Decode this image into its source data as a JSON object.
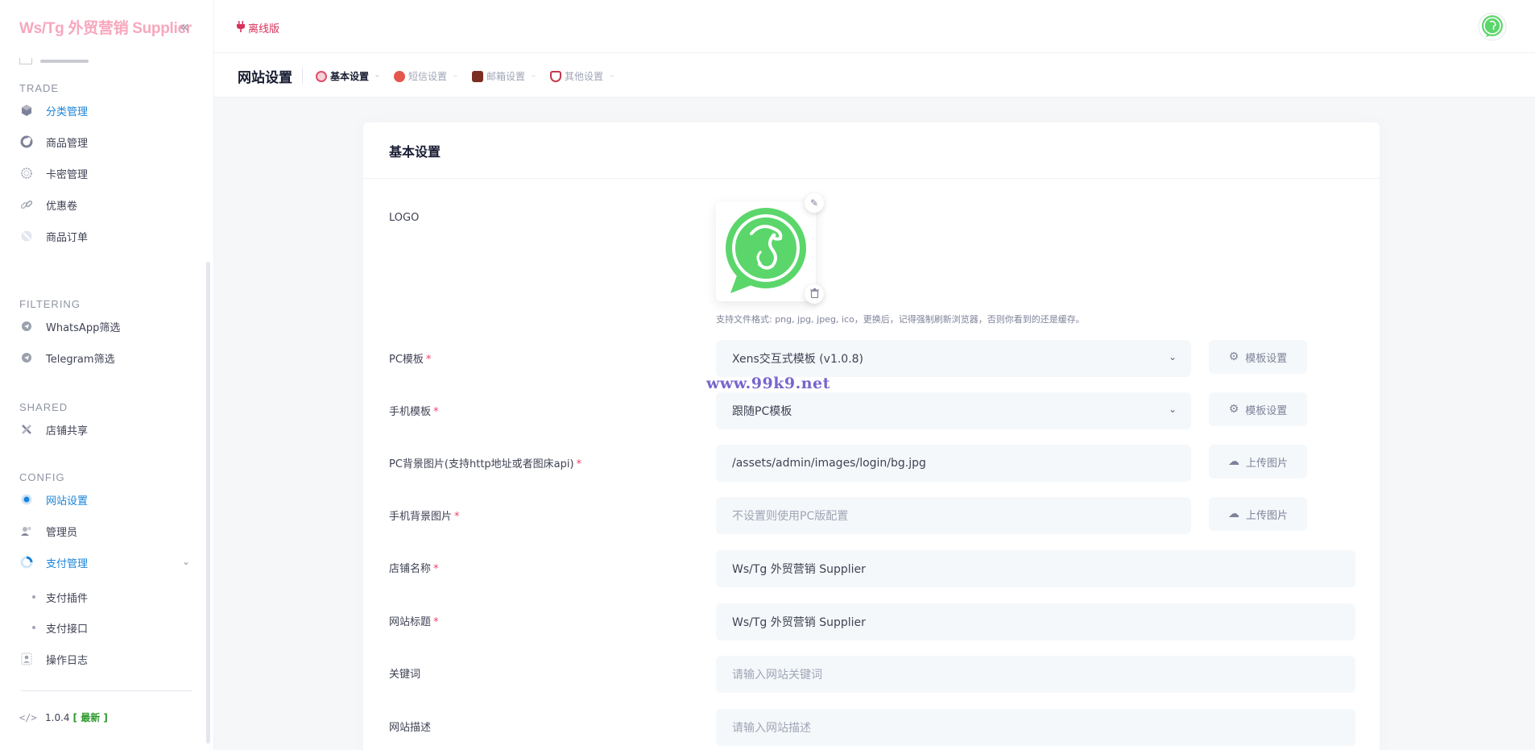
{
  "sidebar": {
    "brand": "Ws/Tg 外贸营销 Supplier",
    "sections": {
      "trade": "TRADE",
      "filtering": "FILTERING",
      "shared": "SHARED",
      "config": "CONFIG"
    },
    "items": {
      "category": "分类管理",
      "goods": "商品管理",
      "cards": "卡密管理",
      "coupon": "优惠卷",
      "orders": "商品订单",
      "whatsapp": "WhatsApp筛选",
      "telegram": "Telegram筛选",
      "shop_share": "店铺共享",
      "site_settings": "网站设置",
      "admins": "管理员",
      "payment": "支付管理",
      "pay_plugins": "支付插件",
      "pay_api": "支付接口",
      "op_log": "操作日志"
    },
    "version": "1.0.4",
    "version_badge": "[ 最新 ]"
  },
  "header": {
    "offline_label": "离线版"
  },
  "toolbar": {
    "title": "网站设置",
    "tabs": [
      "基本设置",
      "短信设置",
      "邮箱设置",
      "其他设置"
    ]
  },
  "form": {
    "card_title": "基本设置",
    "logo_label": "LOGO",
    "logo_hint": "支持文件格式: png, jpg, jpeg, ico，更换后，记得强制刷新浏览器，否则你看到的还是缓存。",
    "pc_template_label": "PC模板",
    "pc_template_value": "Xens交互式模板 (v1.0.8)",
    "template_settings_btn": "模板设置",
    "mobile_template_label": "手机模板",
    "mobile_template_value": "跟随PC模板",
    "pc_bg_label": "PC背景图片(支持http地址或者图床api)",
    "pc_bg_value": "/assets/admin/images/login/bg.jpg",
    "upload_btn": "上传图片",
    "mobile_bg_label": "手机背景图片",
    "mobile_bg_placeholder": "不设置则使用PC版配置",
    "shop_name_label": "店铺名称",
    "shop_name_value": "Ws/Tg 外贸营销 Supplier",
    "site_title_label": "网站标题",
    "site_title_value": "Ws/Tg 外贸营销 Supplier",
    "keywords_label": "关键词",
    "keywords_placeholder": "请输入网站关键词",
    "description_label": "网站描述",
    "description_placeholder": "请输入网站描述",
    "required_mark": "*"
  },
  "watermark": "www.99k9.net",
  "colors": {
    "accent": "#1b84d8",
    "brand_pink": "#f7a7bd",
    "offline_red": "#d8315b",
    "required": "#f1416c",
    "logo_green": "#5bd66b"
  }
}
